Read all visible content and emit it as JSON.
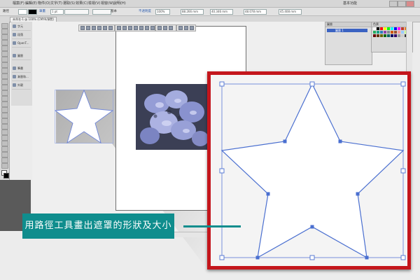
{
  "menubar": {
    "items": [
      "檔案(F)",
      "編輯(E)",
      "物件(O)",
      "文字(T)",
      "選取(S)",
      "效果(C)",
      "檢視(V)",
      "視窗(W)",
      "說明(H)"
    ]
  },
  "toolbar": {
    "mode_label": "路徑",
    "stroke_label": "筆畫",
    "stroke_weight": "1 pt",
    "style_label": "基本",
    "opacity_label": "不透明度",
    "opacity_value": "100%",
    "x_value": "88.266 mm",
    "y_value": "40.346 mm",
    "w_value": "48.078 mm",
    "h_value": "45.408 mm",
    "workspace_label": "基本功能"
  },
  "document_tab": {
    "label": "未命名-1 @ 100% (CMYK/預覽)"
  },
  "panel_column": {
    "items": [
      "字元",
      "段落",
      "OpenT...",
      "圖層",
      "筆畫",
      "漸層和...",
      "外觀"
    ]
  },
  "layers_panel": {
    "tabs": "圖層",
    "row_label": "圖層 1"
  },
  "swatches_panel": {
    "title": "色票"
  },
  "callout": {
    "text": "用路徑工具畫出遮罩的形狀及大小"
  },
  "colors": {
    "accent_red": "#c4161c",
    "callout_teal": "#0f8d8d",
    "path_blue": "#4a6fd0"
  }
}
